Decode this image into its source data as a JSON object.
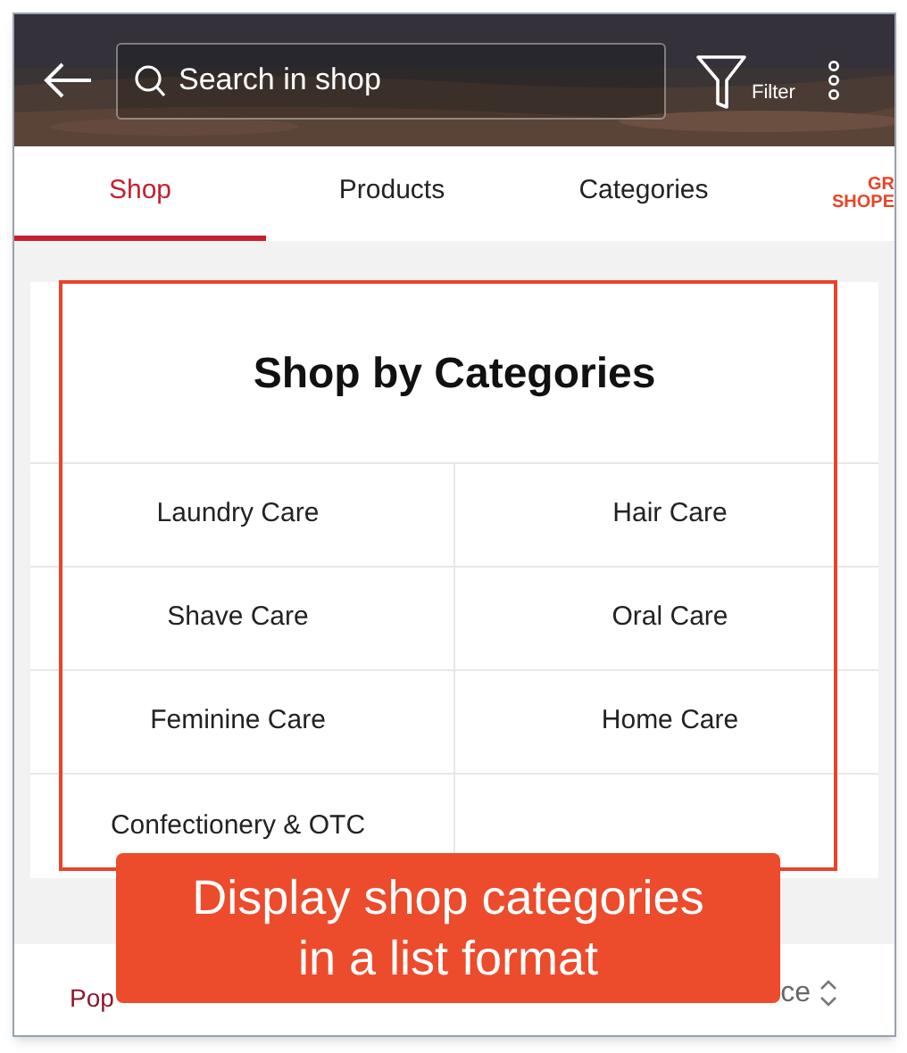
{
  "header": {
    "search": {
      "placeholder": "Search in shop"
    },
    "filter_label": "Filter"
  },
  "tabs": [
    {
      "label": "Shop",
      "selected": true
    },
    {
      "label": "Products",
      "selected": false
    },
    {
      "label": "Categories",
      "selected": false
    }
  ],
  "brand_tab": {
    "lines": [
      "GR",
      "SHOPE"
    ]
  },
  "section": {
    "title": "Shop by Categories",
    "categories": [
      "Laundry Care",
      "Hair Care",
      "Shave Care",
      "Oral Care",
      "Feminine Care",
      "Home Care",
      "Confectionery & OTC"
    ]
  },
  "sort_bar": {
    "left": "Pop",
    "right": "ce"
  },
  "callout": {
    "lines": [
      "Display shop categories",
      "in a list format"
    ]
  }
}
